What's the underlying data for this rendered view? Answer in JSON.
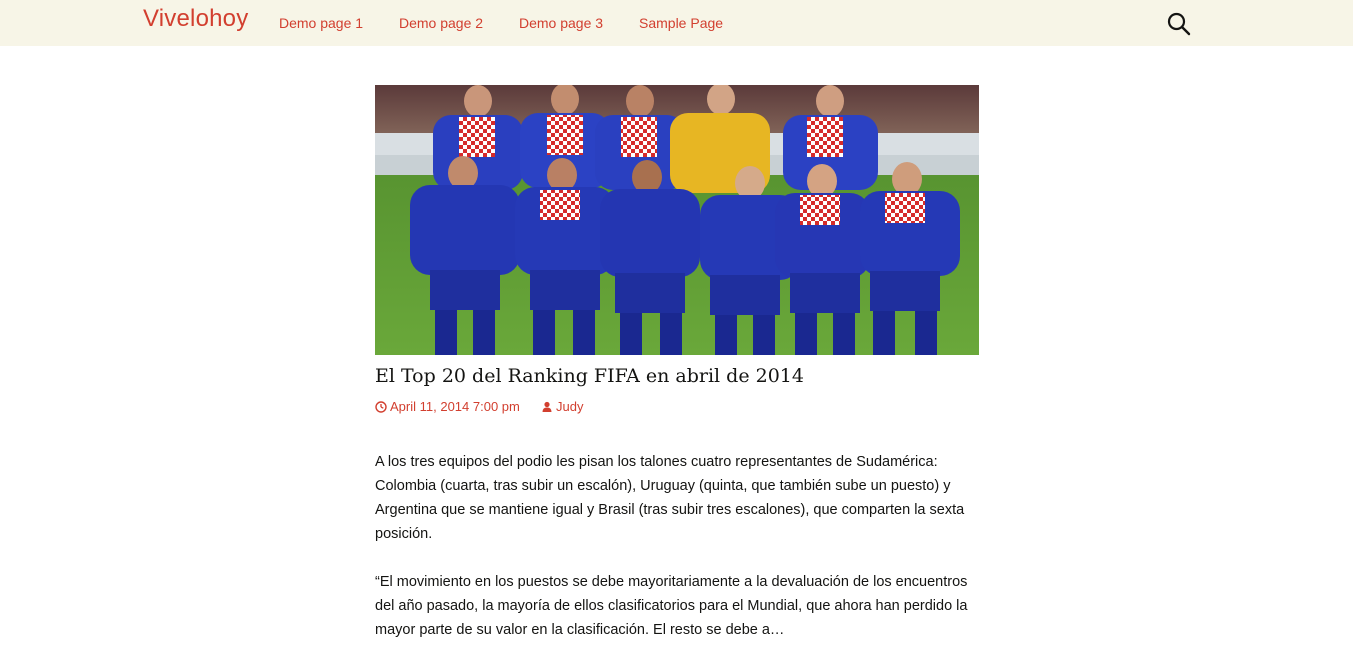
{
  "site": {
    "title": "Vivelohoy"
  },
  "nav": {
    "items": [
      "Demo page 1",
      "Demo page 2",
      "Demo page 3",
      "Sample Page"
    ]
  },
  "icons": {
    "search": "search-icon",
    "clock": "clock-icon",
    "user": "user-icon"
  },
  "colors": {
    "accent": "#d23f2f",
    "header_bg": "#f7f5e7",
    "text": "#141412"
  },
  "post": {
    "title": "El Top 20 del Ranking FIFA en abril de 2014",
    "date": "April 11, 2014 7:00 pm",
    "author": "Judy",
    "paragraphs": [
      "A los tres equipos del podio les pisan los talones cuatro representantes de Sudamérica: Colombia (cuarta, tras subir un escalón), Uruguay (quinta, que también sube un puesto) y Argentina que se mantiene igual y Brasil (tras subir tres escalones), que comparten la sexta posición.",
      "“El movimiento en los puestos se debe mayoritariamente a la devaluación de los encuentros del año pasado, la mayoría de ellos clasificatorios para el Mundial, que ahora han perdido la mayor parte de su valor en la clasificación. El resto se debe a…"
    ]
  }
}
